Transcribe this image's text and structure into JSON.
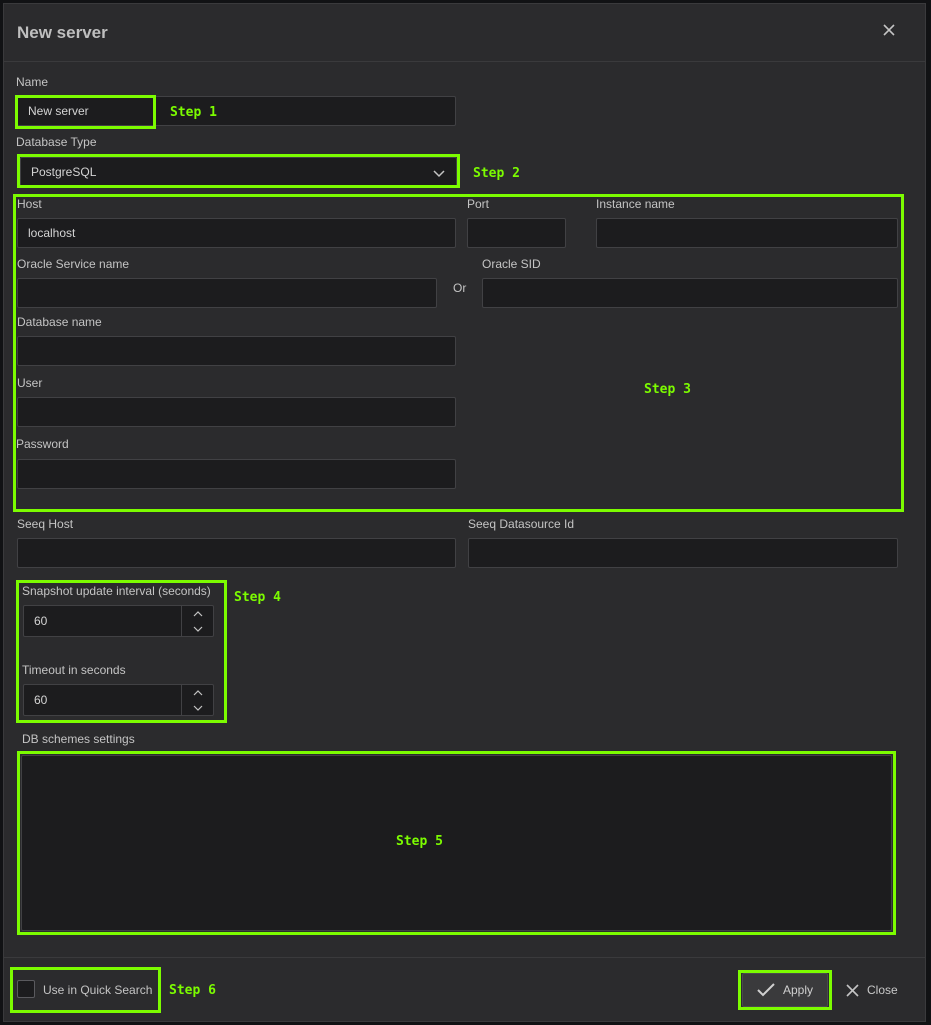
{
  "dialog": {
    "title": "New server",
    "close_icon": "close-icon"
  },
  "form": {
    "name": {
      "label": "Name",
      "value": "New server"
    },
    "database_type": {
      "label": "Database Type",
      "selected": "PostgreSQL",
      "icon": "chevron-down-icon"
    },
    "host": {
      "label": "Host",
      "value": "localhost"
    },
    "port": {
      "label": "Port",
      "value": ""
    },
    "instance_name": {
      "label": "Instance name",
      "value": ""
    },
    "oracle_service_name": {
      "label": "Oracle Service name",
      "value": ""
    },
    "or_label": "Or",
    "oracle_sid": {
      "label": "Oracle SID",
      "value": ""
    },
    "database_name": {
      "label": "Database name",
      "value": ""
    },
    "user": {
      "label": "User",
      "value": ""
    },
    "password": {
      "label": "Password",
      "value": ""
    },
    "seeq_host": {
      "label": "Seeq Host",
      "value": ""
    },
    "seeq_datasource_id": {
      "label": "Seeq Datasource Id",
      "value": ""
    },
    "snapshot_interval": {
      "label": "Snapshot update interval (seconds)",
      "value": "60"
    },
    "timeout": {
      "label": "Timeout in seconds",
      "value": "60"
    },
    "db_schemes": {
      "label": "DB schemes settings",
      "value": ""
    }
  },
  "footer": {
    "quick_search_label": "Use in Quick Search",
    "quick_search_checked": false,
    "apply_label": "Apply",
    "close_label": "Close"
  },
  "annotations": {
    "color": "#7cfc00",
    "step1": "Step 1",
    "step2": "Step 2",
    "step3": "Step 3",
    "step4": "Step 4",
    "step5": "Step 5",
    "step6": "Step 6"
  }
}
